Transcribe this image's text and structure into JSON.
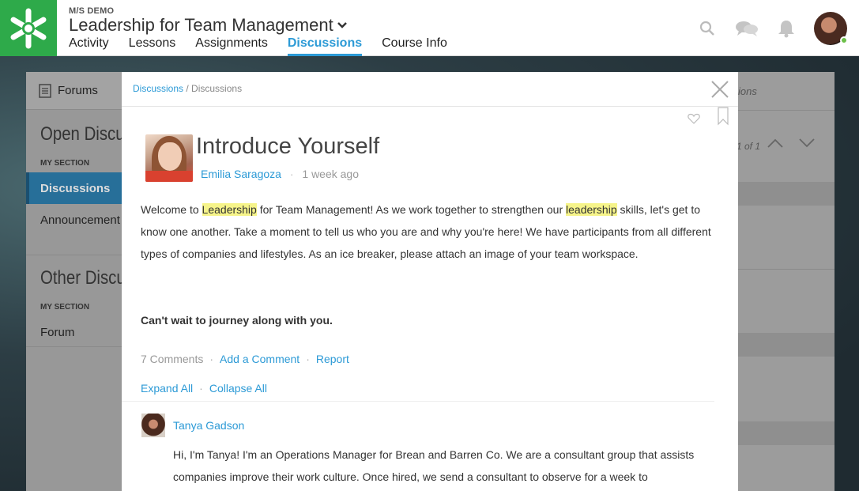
{
  "header": {
    "brand": "M/S DEMO",
    "course_title": "Leadership for Team Management",
    "tabs": [
      {
        "label": "Activity"
      },
      {
        "label": "Lessons"
      },
      {
        "label": "Assignments"
      },
      {
        "label": "Discussions",
        "active": true
      },
      {
        "label": "Course Info"
      }
    ],
    "icons": [
      "search-icon",
      "chat-icon",
      "bell-icon"
    ],
    "accent_color": "#2c9ad6",
    "logo_color": "#2eaa4a"
  },
  "background": {
    "forums_label": "Forums",
    "open_section_title": "Open Discuss",
    "open_sub": "MY SECTION",
    "open_items": [
      "Discussions",
      "Announcement"
    ],
    "other_section_title": "Other Discuss",
    "other_sub": "MY SECTION",
    "other_items": [
      "Forum"
    ],
    "right_partial": "ions",
    "paging": "1 of 1"
  },
  "modal": {
    "breadcrumb_link": "Discussions",
    "breadcrumb_sep": " / ",
    "breadcrumb_current": "Discussions",
    "post": {
      "title": "Introduce Yourself",
      "author": "Emilia Saragoza",
      "time": "1 week ago",
      "body_parts": [
        {
          "text": "Welcome to ",
          "hl": false
        },
        {
          "text": "Leadership",
          "hl": true
        },
        {
          "text": " for Team Management! As we work together to strengthen our ",
          "hl": false
        },
        {
          "text": "leadership",
          "hl": true
        },
        {
          "text": " skills, let's get to know one another. Take a moment to tell us who you are and why you're here! We have participants from all different types of companies and lifestyles. As an ice breaker, please attach an image of your team workspace.",
          "hl": false
        }
      ],
      "closing": "Can't wait to journey along with you.",
      "comments_count": "7 Comments",
      "add_comment": "Add a Comment",
      "report": "Report",
      "expand_all": "Expand All",
      "collapse_all": "Collapse All"
    },
    "reply": {
      "author": "Tanya Gadson",
      "body": "Hi, I'm Tanya! I'm an Operations Manager for Brean and Barren Co. We are a consultant group that assists companies improve their work culture. Once hired, we send a consultant to observe for a week to"
    }
  }
}
